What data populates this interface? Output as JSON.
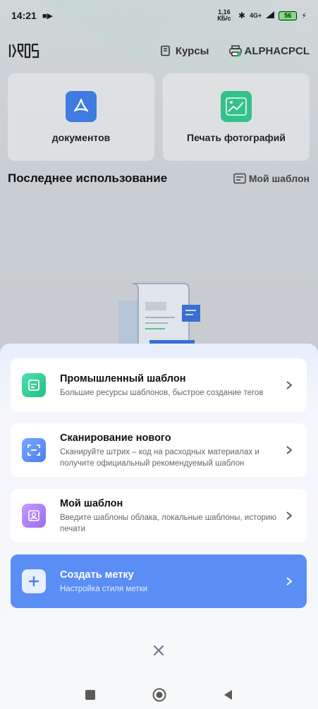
{
  "status_bar": {
    "time": "14:21",
    "net_speed": "1,16 КБ/с",
    "signal": "4G+",
    "battery": "56"
  },
  "header": {
    "courses_label": "Курсы",
    "printer_label": "ALPHACPCL"
  },
  "cards": [
    {
      "label": "документов",
      "icon": "pdf-icon"
    },
    {
      "label": "Печать фотографий",
      "icon": "photo-icon"
    }
  ],
  "recent": {
    "title": "Последнее использование",
    "my_template_label": "Мой шаблон"
  },
  "sheet": {
    "options": [
      {
        "title": "Промышленный шаблон",
        "subtitle": "Большие ресурсы шаблонов, быстрое создание тегов",
        "icon": "industrial-template-icon",
        "color": "#2fd29a"
      },
      {
        "title": "Сканирование нового",
        "subtitle": "Сканируйте штрих – код на расходных материалах и получите официальный рекомендуемый шаблон",
        "icon": "scan-icon",
        "color": "#5b8ef5"
      },
      {
        "title": "Мой шаблон",
        "subtitle": "Введите шаблоны облака, локальные шаблоны, историю печати",
        "icon": "user-template-icon",
        "color": "#a77cf0"
      },
      {
        "title": "Создать метку",
        "subtitle": "Настройка стиля метки",
        "icon": "plus-icon",
        "color": "#5b8ef5"
      }
    ],
    "close_icon": "close-icon"
  },
  "nav": {
    "buttons": [
      "recents-square-icon",
      "home-circle-icon",
      "back-triangle-icon"
    ]
  }
}
